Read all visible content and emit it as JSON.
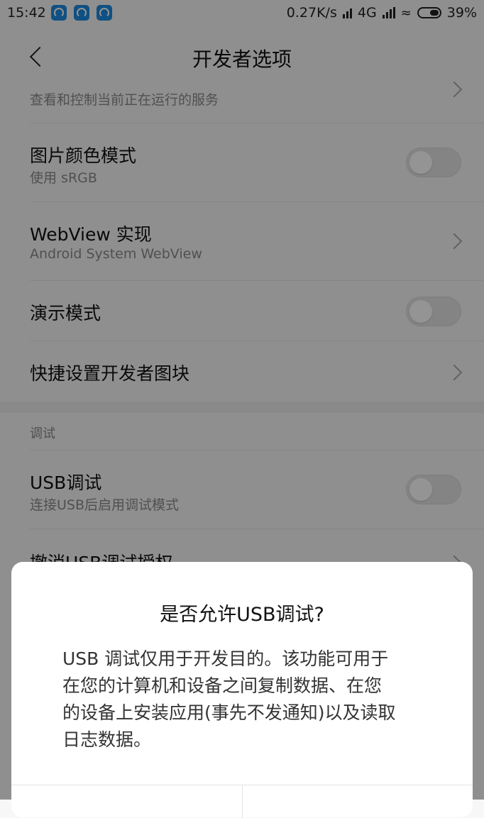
{
  "status_bar": {
    "time": "15:42",
    "network_speed": "0.27K/s",
    "network_type": "4G",
    "battery": "39%"
  },
  "header": {
    "title": "开发者选项"
  },
  "list": {
    "running_services_sub": "查看和控制当前正在运行的服务",
    "picture_color_mode": {
      "title": "图片颜色模式",
      "sub": "使用 sRGB",
      "enabled": false
    },
    "webview": {
      "title": "WebView 实现",
      "sub": "Android System WebView"
    },
    "demo_mode": {
      "title": "演示模式",
      "enabled": false
    },
    "quick_tiles": {
      "title": "快捷设置开发者图块"
    },
    "debug_section": "调试",
    "usb_debugging": {
      "title": "USB调试",
      "sub": "连接USB后启用调试模式",
      "enabled": false
    },
    "revoke_usb": {
      "title": "撤消USB调试授权"
    }
  },
  "dialog": {
    "title": "是否允许USB调试?",
    "message": "USB 调试仅用于开发目的。该功能可用于在您的计算机和设备之间复制数据、在您的设备上安装应用(事先不发通知)以及读取日志数据。"
  },
  "colors": {
    "overlay": "#000000",
    "background": "#f7f7f7",
    "dialog": "#ffffff"
  }
}
